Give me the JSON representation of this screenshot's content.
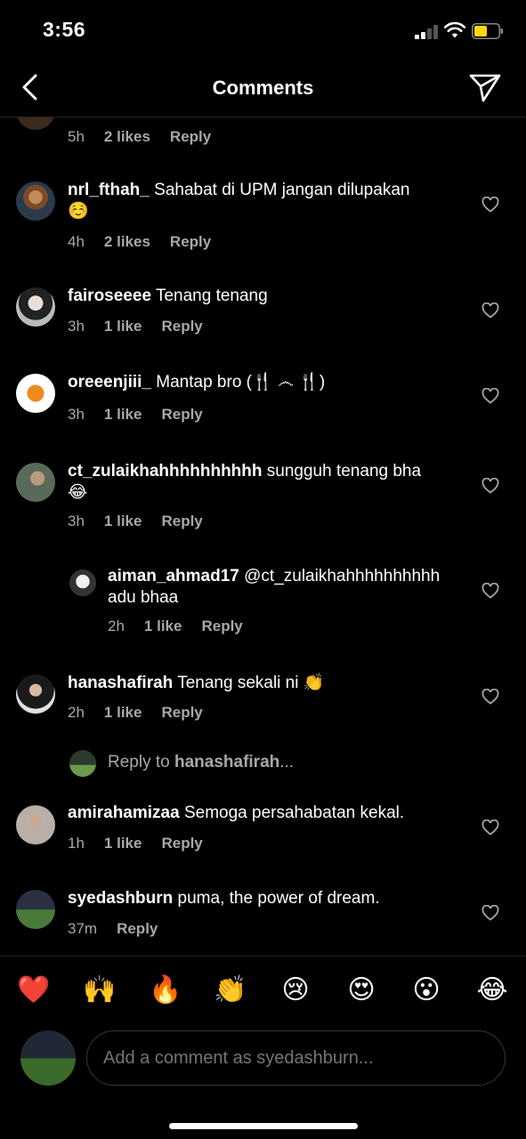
{
  "status_bar": {
    "time": "3:56"
  },
  "header": {
    "title": "Comments"
  },
  "partial_comment": {
    "time": "5h",
    "likes": "2 likes",
    "reply": "Reply"
  },
  "comments": [
    {
      "username": "nrl_fthah_",
      "text": "Sahabat di UPM jangan dilupakan",
      "text_line2": "☺️",
      "time": "4h",
      "likes": "2 likes",
      "reply": "Reply"
    },
    {
      "username": "fairoseeee",
      "text": "Tenang tenang",
      "time": "3h",
      "likes": "1 like",
      "reply": "Reply"
    },
    {
      "username": "oreeenjiii_",
      "text": "Mantap bro (🍴 ෴ 🍴)",
      "time": "3h",
      "likes": "1 like",
      "reply": "Reply"
    },
    {
      "username": "ct_zulaikhahhhhhhhhhh",
      "text": "sungguh tenang bha",
      "text_line2": "😂",
      "time": "3h",
      "likes": "1 like",
      "reply": "Reply"
    },
    {
      "username": "aiman_ahmad17",
      "text": "@ct_zulaikhahhhhhhhhhh",
      "text_line2": "adu bhaa",
      "time": "2h",
      "likes": "1 like",
      "reply": "Reply"
    },
    {
      "username": "hanashafirah",
      "text": "Tenang sekali ni 👏",
      "time": "2h",
      "likes": "1 like",
      "reply": "Reply"
    },
    {
      "username": "amirahamizaa",
      "text": "Semoga persahabatan kekal.",
      "time": "1h",
      "likes": "1 like",
      "reply": "Reply"
    },
    {
      "username": "syedashburn",
      "text": "puma, the power of dream.",
      "time": "37m",
      "reply": "Reply"
    }
  ],
  "reply_prompt": {
    "prefix": "Reply to ",
    "username": "hanashafirah",
    "suffix": "..."
  },
  "emoji_bar": [
    "❤️",
    "🙌",
    "🔥",
    "👏",
    "😢",
    "😍",
    "😮",
    "😂"
  ],
  "composer": {
    "placeholder": "Add a comment as syedashburn..."
  },
  "colors": {
    "background": "#000000",
    "secondary_text": "#a8a8a8",
    "divider": "#262626"
  }
}
